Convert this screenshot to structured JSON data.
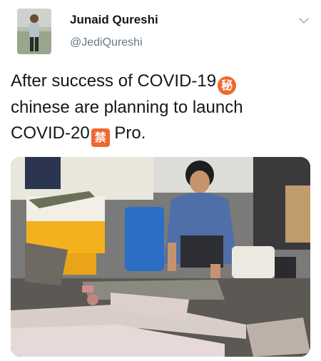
{
  "tweet": {
    "author": {
      "display_name": "Junaid Qureshi",
      "handle": "@JediQureshi"
    },
    "text_lines": [
      {
        "text": "After success of COVID-19",
        "emoji": "secret-emoji"
      },
      {
        "text": "chinese are planning to launch",
        "emoji": ""
      },
      {
        "text": "COVID-20",
        "emoji": "prohibited-emoji",
        "after": " Pro."
      }
    ],
    "emoji_glyphs": {
      "secret": "秘",
      "prohibited": "禁"
    },
    "menu_icon": "chevron-down-icon",
    "photo_description_icon": "market-photo"
  },
  "colors": {
    "text": "#14171a",
    "handle": "#657786",
    "emoji_orange": "#f0672f"
  }
}
